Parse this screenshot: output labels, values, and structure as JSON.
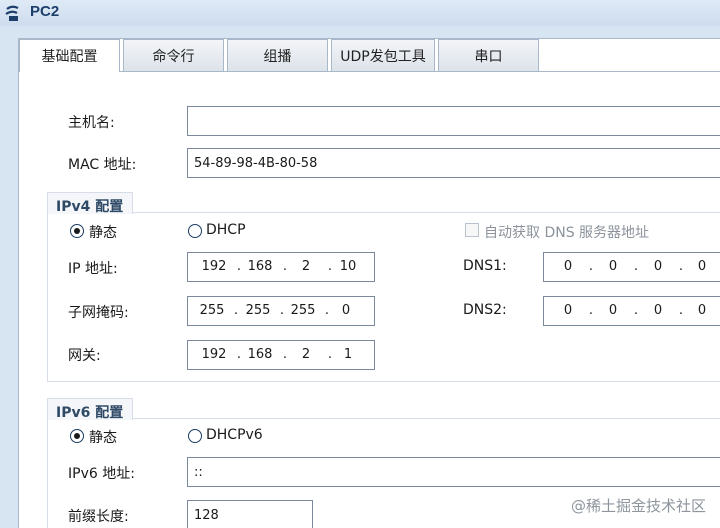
{
  "window": {
    "title": "PC2"
  },
  "tabs": [
    "基础配置",
    "命令行",
    "组播",
    "UDP发包工具",
    "串口"
  ],
  "basic": {
    "hostname_label": "主机名:",
    "hostname_value": "",
    "mac_label": "MAC 地址:",
    "mac_value": "54-89-98-4B-80-58"
  },
  "ipv4": {
    "title": "IPv4 配置",
    "static_label": "静态",
    "dhcp_label": "DHCP",
    "auto_dns_label": "自动获取 DNS 服务器地址",
    "ip_label": "IP 地址:",
    "ip": [
      "192",
      "168",
      "2",
      "10"
    ],
    "mask_label": "子网掩码:",
    "mask": [
      "255",
      "255",
      "255",
      "0"
    ],
    "gateway_label": "网关:",
    "gateway": [
      "192",
      "168",
      "2",
      "1"
    ],
    "dns1_label": "DNS1:",
    "dns1": [
      "0",
      "0",
      "0",
      "0"
    ],
    "dns2_label": "DNS2:",
    "dns2": [
      "0",
      "0",
      "0",
      "0"
    ],
    "mode": "static"
  },
  "ipv6": {
    "title": "IPv6 配置",
    "static_label": "静态",
    "dhcp_label": "DHCPv6",
    "ip_label": "IPv6 地址:",
    "ip_value": "::",
    "prefix_label": "前缀长度:",
    "prefix_value": "128",
    "mode": "static"
  },
  "watermark": "@稀土掘金技术社区"
}
